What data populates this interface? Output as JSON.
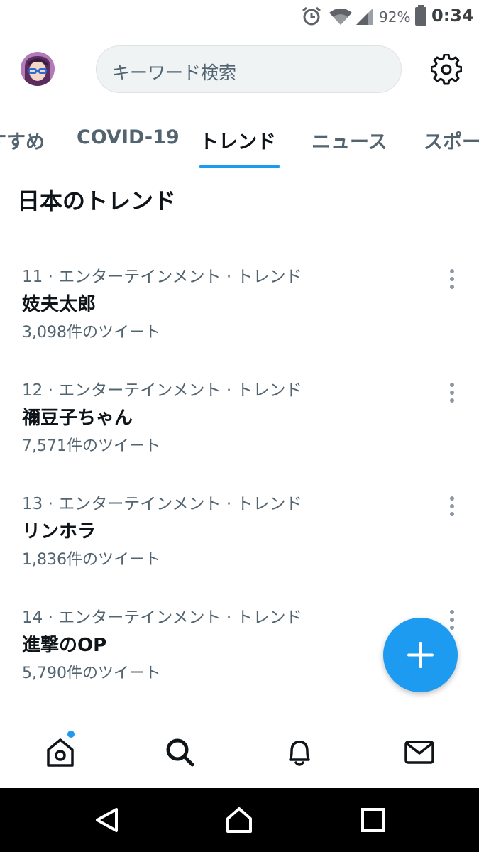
{
  "status_bar": {
    "battery": "92%",
    "time": "0:34",
    "icons": [
      "alarm-icon",
      "wifi-icon",
      "signal-icon",
      "battery-icon"
    ]
  },
  "search": {
    "placeholder": "キーワード検索"
  },
  "tabs": [
    {
      "label": "すすめ",
      "active": false
    },
    {
      "label": "COVID-19",
      "active": false
    },
    {
      "label": "トレンド",
      "active": true
    },
    {
      "label": "ニュース",
      "active": false
    },
    {
      "label": "スポーツ",
      "active": false
    }
  ],
  "section": {
    "title": "日本のトレンド"
  },
  "trends": [
    {
      "meta": "11 · エンターテインメント · トレンド",
      "title": "妓夫太郎",
      "count": "3,098件のツイート"
    },
    {
      "meta": "12 · エンターテインメント · トレンド",
      "title": "禰豆子ちゃん",
      "count": "7,571件のツイート"
    },
    {
      "meta": "13 · エンターテインメント · トレンド",
      "title": "リンホラ",
      "count": "1,836件のツイート"
    },
    {
      "meta": "14 · エンターテインメント · トレンド",
      "title": "進撃のOP",
      "count": "5,790件のツイート"
    }
  ],
  "colors": {
    "accent": "#1d9bf0",
    "text": "#0f1419",
    "muted": "#536471"
  },
  "bottom_nav": [
    "home-icon",
    "search-icon",
    "bell-icon",
    "mail-icon"
  ]
}
